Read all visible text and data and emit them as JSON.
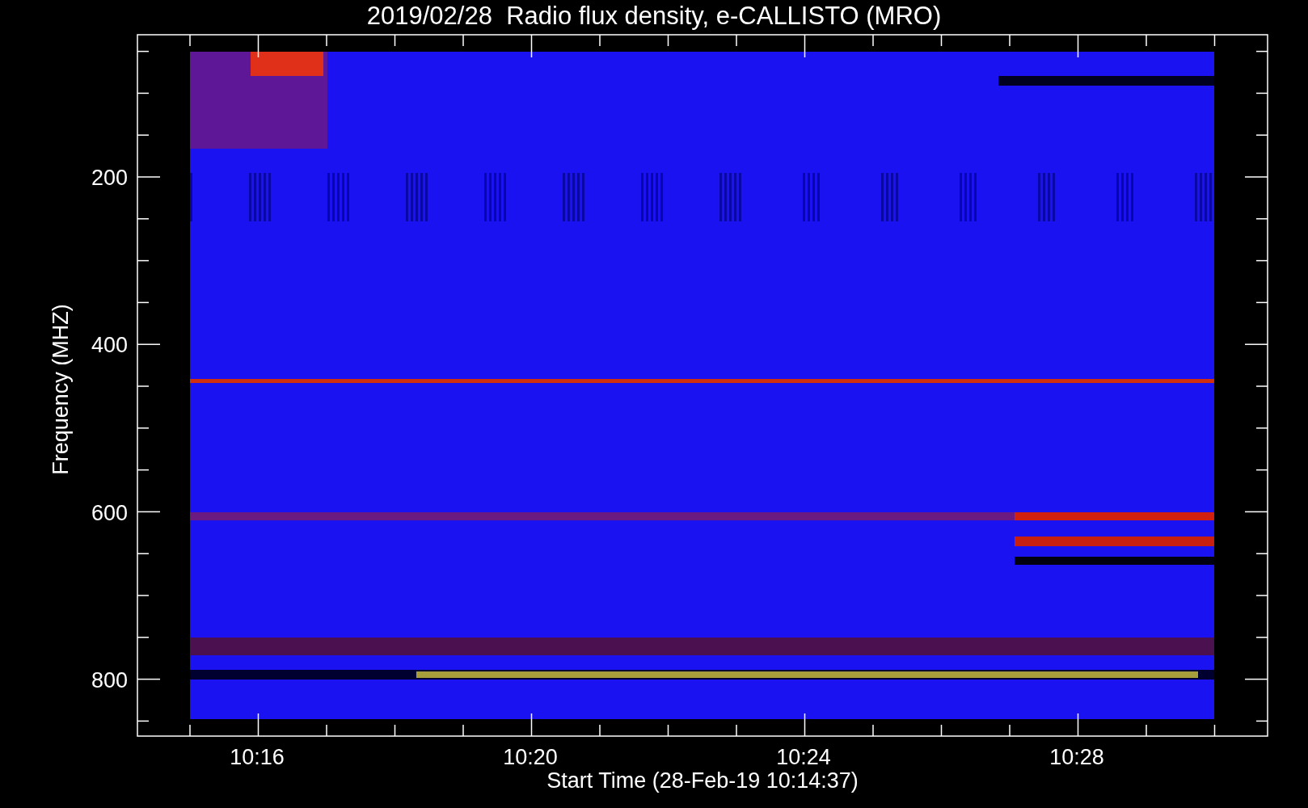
{
  "title": "2019/02/28  Radio flux density, e-CALLISTO (MRO)",
  "ylabel": "Frequency (MHZ)",
  "xlabel": "Start Time (28-Feb-19 10:14:37)",
  "yticks": [
    "200",
    "400",
    "600",
    "800"
  ],
  "xticks": [
    "10:16",
    "10:20",
    "10:24",
    "10:28"
  ]
}
